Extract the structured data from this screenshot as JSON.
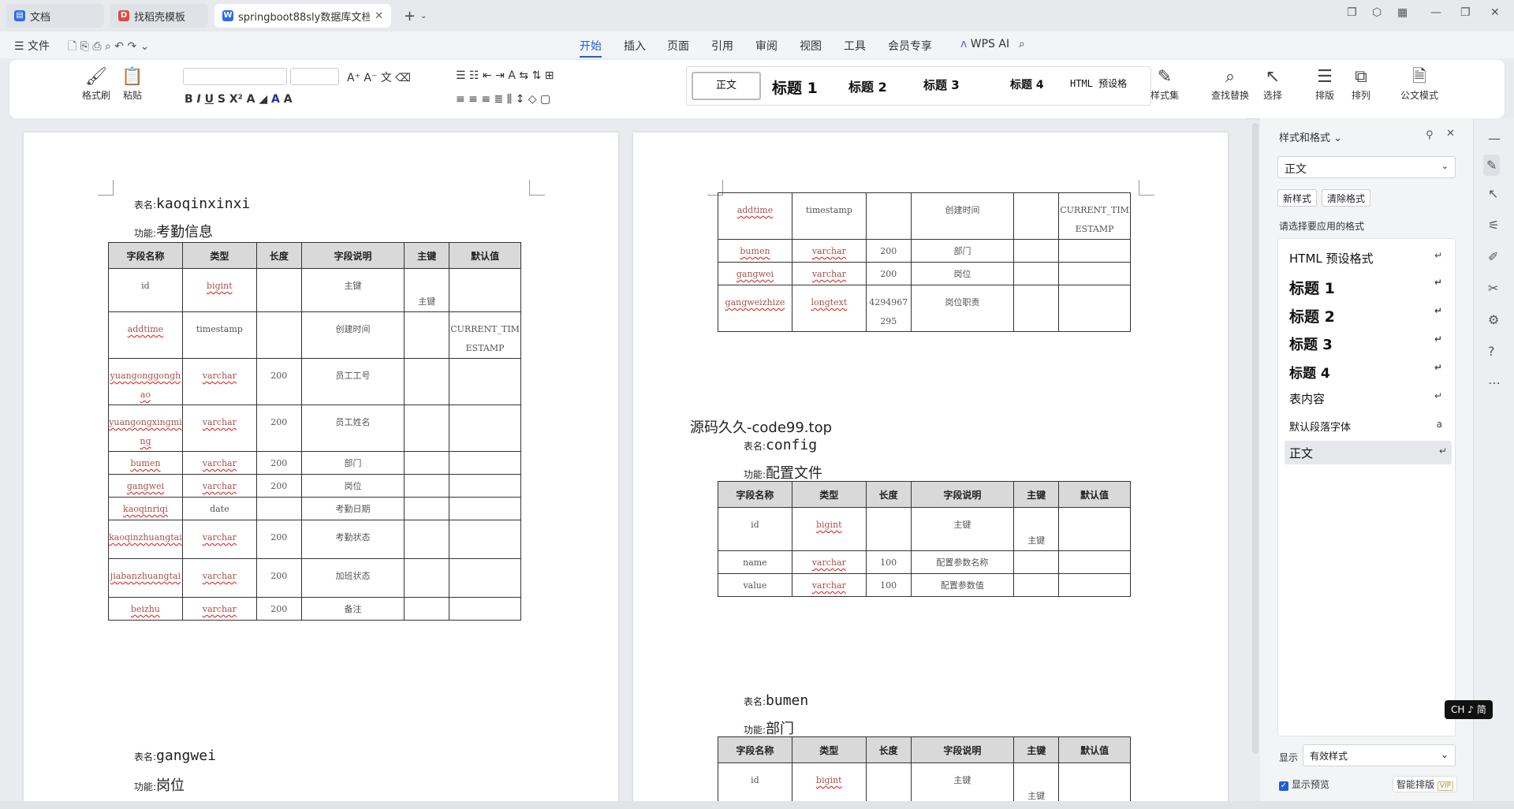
{
  "tabs": [
    {
      "label": "文档",
      "icon": "doc-icon",
      "color": "#2b6de5"
    },
    {
      "label": "找稻壳模板",
      "icon": "docer-icon",
      "color": "#e54848"
    },
    {
      "label": "springboot88sly数据库文档",
      "icon": "word-icon",
      "color": "#2b6de5"
    }
  ],
  "menu": {
    "file": "文件",
    "items": [
      "开始",
      "插入",
      "页面",
      "引用",
      "审阅",
      "视图",
      "工具",
      "会员专享"
    ],
    "wps_ai": "WPS AI"
  },
  "ribbon": {
    "format_painter": "格式刷",
    "paste": "粘贴",
    "styles": [
      "正文",
      "标题 1",
      "标题 2",
      "标题 3",
      "标题 4",
      "HTML 预设格"
    ],
    "style_set": "样式集",
    "find_replace": "查找替换",
    "select": "选择",
    "layout": "排版",
    "arrange": "排列",
    "official": "公文模式",
    "accent": "#1f5fd6"
  },
  "headers": [
    "字段名称",
    "类型",
    "长度",
    "字段说明",
    "主键",
    "默认值"
  ],
  "page1": {
    "t1_label": "表名:",
    "t1_name": "kaoqinxinxi",
    "t1_fn_label": "功能:",
    "t1_fn": "考勤信息",
    "rows": [
      [
        "id",
        "bigint",
        "",
        "主键",
        "主键",
        ""
      ],
      [
        "addtime",
        "timestamp",
        "",
        "创建时间",
        "",
        "CURRENT_TIMESTAMP"
      ],
      [
        "yuangonggonghao",
        "varchar",
        "200",
        "员工工号",
        "",
        ""
      ],
      [
        "yuangongxingming",
        "varchar",
        "200",
        "员工姓名",
        "",
        ""
      ],
      [
        "bumen",
        "varchar",
        "200",
        "部门",
        "",
        ""
      ],
      [
        "gangwei",
        "varchar",
        "200",
        "岗位",
        "",
        ""
      ],
      [
        "kaoqinriqi",
        "date",
        "",
        "考勤日期",
        "",
        ""
      ],
      [
        "kaoqinzhuangtai",
        "varchar",
        "200",
        "考勤状态",
        "",
        ""
      ],
      [
        "jiabanzhuangtai",
        "varchar",
        "200",
        "加班状态",
        "",
        ""
      ],
      [
        "beizhu",
        "varchar",
        "200",
        "备注",
        "",
        ""
      ]
    ],
    "t2_label": "表名:",
    "t2_name": "gangwei",
    "t2_fn_label": "功能:",
    "t2_fn": "岗位"
  },
  "page2": {
    "cont_rows": [
      [
        "addtime",
        "timestamp",
        "",
        "创建时间",
        "",
        "CURRENT_TIMESTAMP"
      ],
      [
        "bumen",
        "varchar",
        "200",
        "部门",
        "",
        ""
      ],
      [
        "gangwei",
        "varchar",
        "200",
        "岗位",
        "",
        ""
      ],
      [
        "gangweizhize",
        "longtext",
        "4294967295",
        "岗位职责",
        "",
        ""
      ]
    ],
    "watermark": "源码久久-code99.top",
    "t3_label": "表名:",
    "t3_name": "config",
    "t3_fn_label": "功能:",
    "t3_fn": "配置文件",
    "config_rows": [
      [
        "id",
        "bigint",
        "",
        "主键",
        "主键",
        ""
      ],
      [
        "name",
        "varchar",
        "100",
        "配置参数名称",
        "",
        ""
      ],
      [
        "value",
        "varchar",
        "100",
        "配置参数值",
        "",
        ""
      ]
    ],
    "t4_label": "表名:",
    "t4_name": "bumen",
    "t4_fn_label": "功能:",
    "t4_fn": "部门",
    "bumen_rows": [
      [
        "id",
        "bigint",
        "",
        "主键",
        "主键",
        ""
      ]
    ]
  },
  "panel": {
    "title": "样式和格式",
    "current": "正文",
    "new_btn": "新样式",
    "clear_btn": "清除格式",
    "hint": "请选择要应用的格式",
    "styles": [
      "HTML 预设格式",
      "标题 1",
      "标题 2",
      "标题 3",
      "标题 4",
      "表内容",
      "默认段落字体",
      "正文"
    ],
    "show_label": "显示",
    "show_value": "有效样式",
    "preview": "显示预览",
    "smart": "智能排版",
    "vip": "VIP"
  },
  "ime": "CH ♪ 简"
}
